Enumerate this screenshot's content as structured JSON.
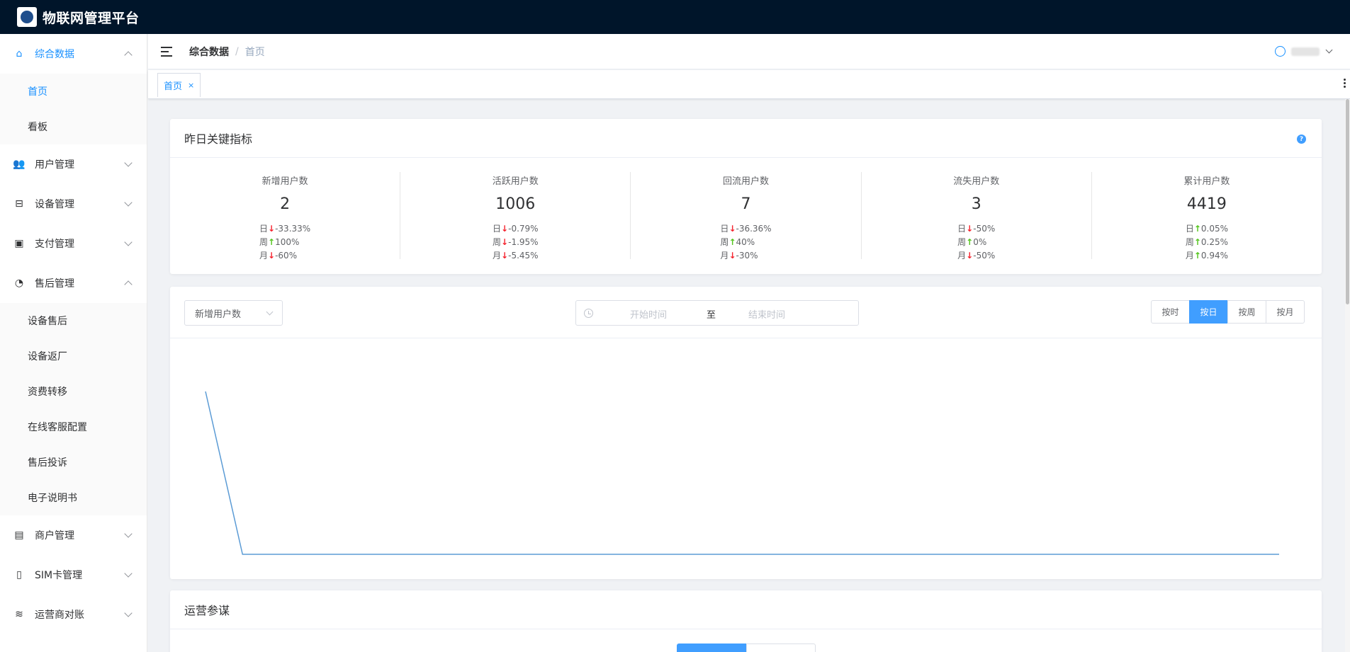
{
  "app": {
    "title": "物联网管理平台"
  },
  "sidebar": {
    "groups": [
      {
        "label": "综合数据",
        "icon": "home-icon",
        "expanded": true,
        "active": true,
        "items": [
          {
            "label": "首页",
            "active": true
          },
          {
            "label": "看板"
          }
        ]
      },
      {
        "label": "用户管理",
        "icon": "users-icon"
      },
      {
        "label": "设备管理",
        "icon": "router-icon"
      },
      {
        "label": "支付管理",
        "icon": "wallet-icon"
      },
      {
        "label": "售后管理",
        "icon": "service-icon",
        "expanded": true,
        "items": [
          {
            "label": "设备售后"
          },
          {
            "label": "设备返厂"
          },
          {
            "label": "资费转移"
          },
          {
            "label": "在线客服配置"
          },
          {
            "label": "售后投诉"
          },
          {
            "label": "电子说明书"
          }
        ]
      },
      {
        "label": "商户管理",
        "icon": "store-icon"
      },
      {
        "label": "SIM卡管理",
        "icon": "sim-card-icon"
      },
      {
        "label": "运营商对账",
        "icon": "layers-icon"
      }
    ]
  },
  "header": {
    "breadcrumb": [
      "综合数据",
      "首页"
    ],
    "breadcrumb_separator": "/"
  },
  "tags": {
    "items": [
      {
        "label": "首页",
        "close": "×"
      }
    ]
  },
  "kpi": {
    "title": "昨日关键指标",
    "help": "?",
    "metrics": [
      {
        "label": "新增用户数",
        "value": "2",
        "rows": [
          {
            "period": "日",
            "dir": "down",
            "arrow": "↓",
            "pct": "-33.33%"
          },
          {
            "period": "周",
            "dir": "up",
            "arrow": "↑",
            "pct": "100%"
          },
          {
            "period": "月",
            "dir": "down",
            "arrow": "↓",
            "pct": "-60%"
          }
        ]
      },
      {
        "label": "活跃用户数",
        "value": "1006",
        "rows": [
          {
            "period": "日",
            "dir": "down",
            "arrow": "↓",
            "pct": "-0.79%"
          },
          {
            "period": "周",
            "dir": "down",
            "arrow": "↓",
            "pct": "-1.95%"
          },
          {
            "period": "月",
            "dir": "down",
            "arrow": "↓",
            "pct": "-5.45%"
          }
        ]
      },
      {
        "label": "回流用户数",
        "value": "7",
        "rows": [
          {
            "period": "日",
            "dir": "down",
            "arrow": "↓",
            "pct": "-36.36%"
          },
          {
            "period": "周",
            "dir": "up",
            "arrow": "↑",
            "pct": "40%"
          },
          {
            "period": "月",
            "dir": "down",
            "arrow": "↓",
            "pct": "-30%"
          }
        ]
      },
      {
        "label": "流失用户数",
        "value": "3",
        "rows": [
          {
            "period": "日",
            "dir": "down",
            "arrow": "↓",
            "pct": "-50%"
          },
          {
            "period": "周",
            "dir": "up",
            "arrow": "↑",
            "pct": "0%"
          },
          {
            "period": "月",
            "dir": "down",
            "arrow": "↓",
            "pct": "-50%"
          }
        ]
      },
      {
        "label": "累计用户数",
        "value": "4419",
        "rows": [
          {
            "period": "日",
            "dir": "up",
            "arrow": "↑",
            "pct": "0.05%"
          },
          {
            "period": "周",
            "dir": "up",
            "arrow": "↑",
            "pct": "0.25%"
          },
          {
            "period": "月",
            "dir": "up",
            "arrow": "↑",
            "pct": "0.94%"
          }
        ]
      }
    ]
  },
  "trend": {
    "metric_select": "新增用户数",
    "date_start_placeholder": "开始时间",
    "date_separator": "至",
    "date_end_placeholder": "结束时间",
    "granularity": [
      {
        "label": "按时"
      },
      {
        "label": "按日",
        "active": true
      },
      {
        "label": "按周"
      },
      {
        "label": "按月"
      }
    ]
  },
  "chart_data": {
    "type": "line",
    "series": [
      {
        "color": "#5b9bd5",
        "values": [
          1,
          0,
          0,
          0,
          0,
          0,
          0,
          0,
          0,
          0,
          0,
          0,
          0,
          0,
          0,
          0,
          0,
          0,
          0,
          0,
          0,
          0,
          0,
          0,
          0,
          0,
          0,
          0,
          0,
          0
        ]
      }
    ],
    "ylim": [
      0,
      1
    ],
    "grid": false,
    "legend": "none"
  },
  "ops": {
    "title": "运营参谋"
  },
  "colors": {
    "topbar": "#00152a",
    "accent": "#1890ff",
    "up": "#52c41a",
    "down": "#f5222d"
  }
}
